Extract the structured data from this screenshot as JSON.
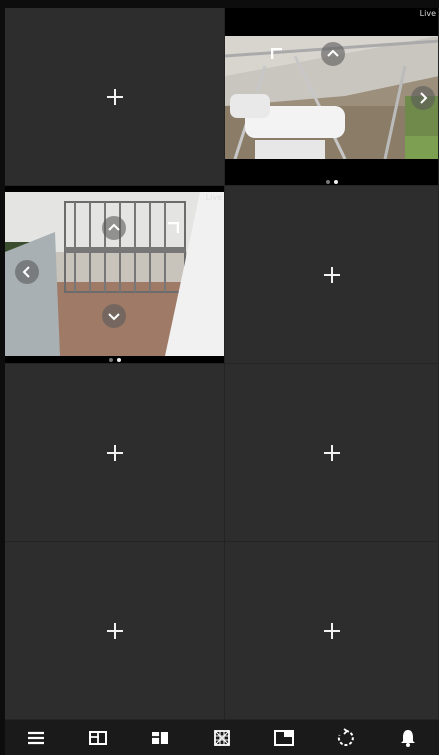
{
  "cameras": {
    "cam1": {
      "live_label": "Live"
    },
    "cam2": {
      "live_label": "Live"
    }
  },
  "grid": {
    "empty_slot_label": "+"
  },
  "colors": {
    "background": "#2d2d2d",
    "accent": "#ffffff",
    "toolbar": "#1a1a1a"
  },
  "toolbar": {
    "icons": [
      "menu-icon",
      "layout-single-icon",
      "layout-split-icon",
      "grid-icon",
      "pip-icon",
      "rotate-icon",
      "bell-icon"
    ]
  }
}
